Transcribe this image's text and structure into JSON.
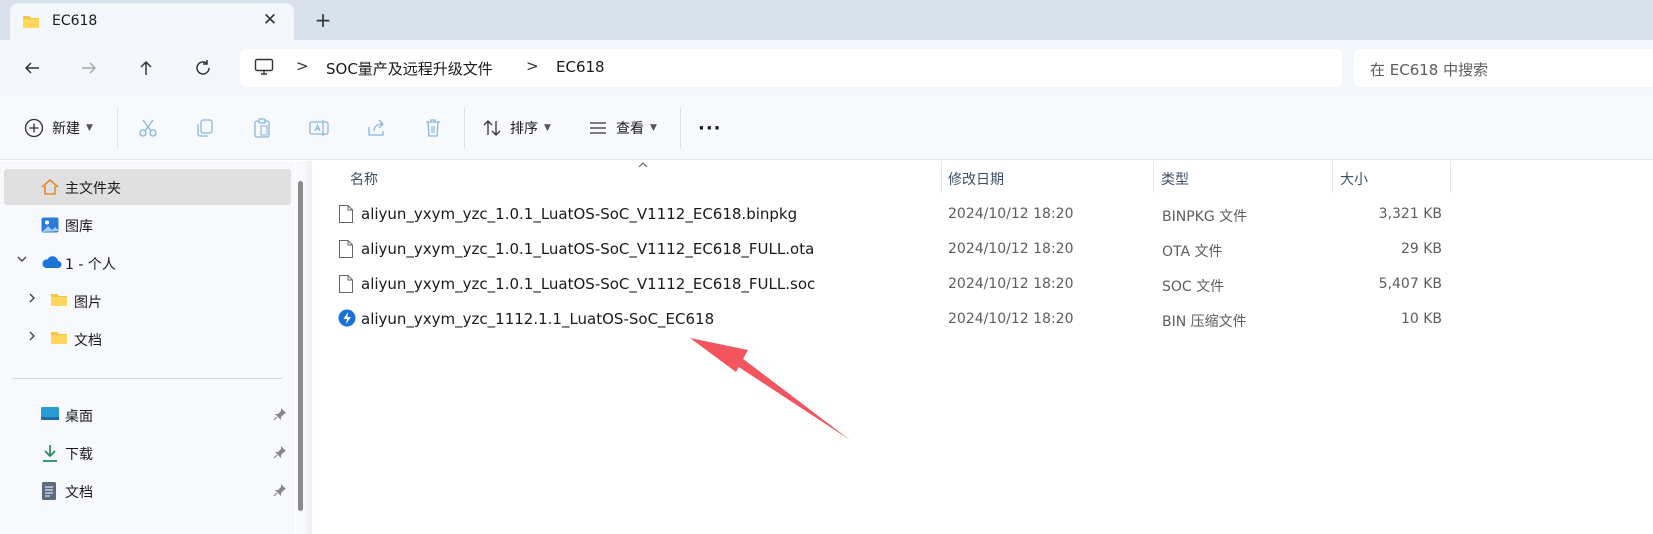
{
  "tab": {
    "title": "EC618",
    "close_label": "✕",
    "new_tab_label": "+"
  },
  "address": {
    "crumbs": [
      "SOC量产及远程升级文件",
      "EC618"
    ],
    "separator": ">"
  },
  "search": {
    "placeholder": "在 EC618 中搜索"
  },
  "toolbar": {
    "new_label": "新建",
    "sort_label": "排序",
    "view_label": "查看",
    "more_label": "···"
  },
  "sidebar": {
    "items": [
      {
        "label": "主文件夹",
        "icon": "home-icon"
      },
      {
        "label": "图库",
        "icon": "gallery-icon"
      },
      {
        "label": "1 - 个人",
        "icon": "onedrive-cloud-icon"
      },
      {
        "label": "图片",
        "icon": "folder-icon"
      },
      {
        "label": "文档",
        "icon": "folder-icon"
      },
      {
        "label": "桌面",
        "icon": "desktop-icon"
      },
      {
        "label": "下载",
        "icon": "download-icon"
      },
      {
        "label": "文档",
        "icon": "document-icon"
      }
    ]
  },
  "columns": {
    "name": "名称",
    "date": "修改日期",
    "type": "类型",
    "size": "大小"
  },
  "files": [
    {
      "name": "aliyun_yxym_yzc_1.0.1_LuatOS-SoC_V1112_EC618.binpkg",
      "date": "2024/10/12 18:20",
      "type": "BINPKG 文件",
      "size": "3,321 KB",
      "icon": "file-icon"
    },
    {
      "name": "aliyun_yxym_yzc_1.0.1_LuatOS-SoC_V1112_EC618_FULL.ota",
      "date": "2024/10/12 18:20",
      "type": "OTA 文件",
      "size": "29 KB",
      "icon": "file-icon"
    },
    {
      "name": "aliyun_yxym_yzc_1.0.1_LuatOS-SoC_V1112_EC618_FULL.soc",
      "date": "2024/10/12 18:20",
      "type": "SOC 文件",
      "size": "5,407 KB",
      "icon": "file-icon"
    },
    {
      "name": "aliyun_yxym_yzc_1112.1.1_LuatOS-SoC_EC618",
      "date": "2024/10/12 18:20",
      "type": "BIN 压缩文件",
      "size": "10 KB",
      "icon": "archive-app-icon"
    }
  ],
  "colors": {
    "accent": "#0067c0",
    "annotation_arrow": "#f2555d"
  }
}
